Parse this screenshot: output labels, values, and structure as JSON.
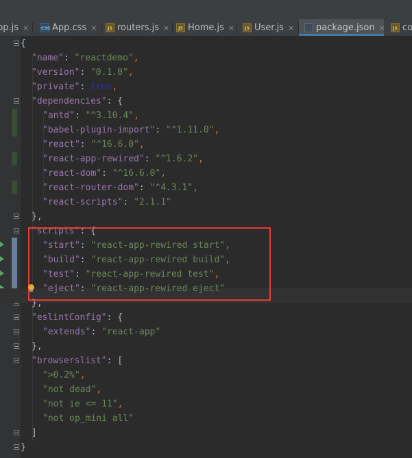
{
  "tabs": [
    {
      "label": "pp.js",
      "icon": "js-file-icon",
      "active": false
    },
    {
      "label": "App.css",
      "icon": "css-file-icon",
      "active": false
    },
    {
      "label": "routers.js",
      "icon": "js-file-icon",
      "active": false
    },
    {
      "label": "Home.js",
      "icon": "js-file-icon",
      "active": false
    },
    {
      "label": "User.js",
      "icon": "js-file-icon",
      "active": false
    },
    {
      "label": "package.json",
      "icon": "json-file-icon",
      "active": true
    },
    {
      "label": "co",
      "icon": "js-file-icon",
      "active": false
    }
  ],
  "icons": {
    "js": "JS",
    "css": "CSS",
    "close": "×"
  },
  "code": {
    "l1": "{",
    "name_key": "\"name\"",
    "name_val": "\"reactdemo\"",
    "version_key": "\"version\"",
    "version_val": "\"0.1.0\"",
    "private_key": "\"private\"",
    "private_val": "true",
    "dependencies_key": "\"dependencies\"",
    "antd_key": "\"antd\"",
    "antd_val": "\"^3.10.4\"",
    "babel_key": "\"babel-plugin-import\"",
    "babel_val": "\"^1.11.0\"",
    "react_key": "\"react\"",
    "react_val": "\"^16.6.0\"",
    "rar_key": "\"react-app-rewired\"",
    "rar_val": "\"^1.6.2\"",
    "rdom_key": "\"react-dom\"",
    "rdom_val": "\"^16.6.0\"",
    "rrdom_key": "\"react-router-dom\"",
    "rrdom_val": "\"^4.3.1\"",
    "rscripts_key": "\"react-scripts\"",
    "rscripts_val": "\"2.1.1\"",
    "scripts_key": "\"scripts\"",
    "start_key": "\"start\"",
    "start_val": "\"react-app-rewired start\"",
    "build_key": "\"build\"",
    "build_val": "\"react-app-rewired build\"",
    "test_key": "\"test\"",
    "test_val": "\"react-app-rewired test\"",
    "eject_key": "\"eject\"",
    "eject_val": "\"react-app-rewired eject\"",
    "eslint_key": "\"eslintConfig\"",
    "extends_key": "\"extends\"",
    "extends_val": "\"react-app\"",
    "browserslist_key": "\"browserslist\"",
    "bl1": "\">0.2%\"",
    "bl2": "\"not dead\"",
    "bl3": "\"not ie <= 11\"",
    "bl4": "\"not op_mini all\"",
    "colon": ": ",
    "comma": ",",
    "obr": "{",
    "cbr": "}",
    "cbrc": "},",
    "oarr": "[",
    "carr": "]"
  }
}
